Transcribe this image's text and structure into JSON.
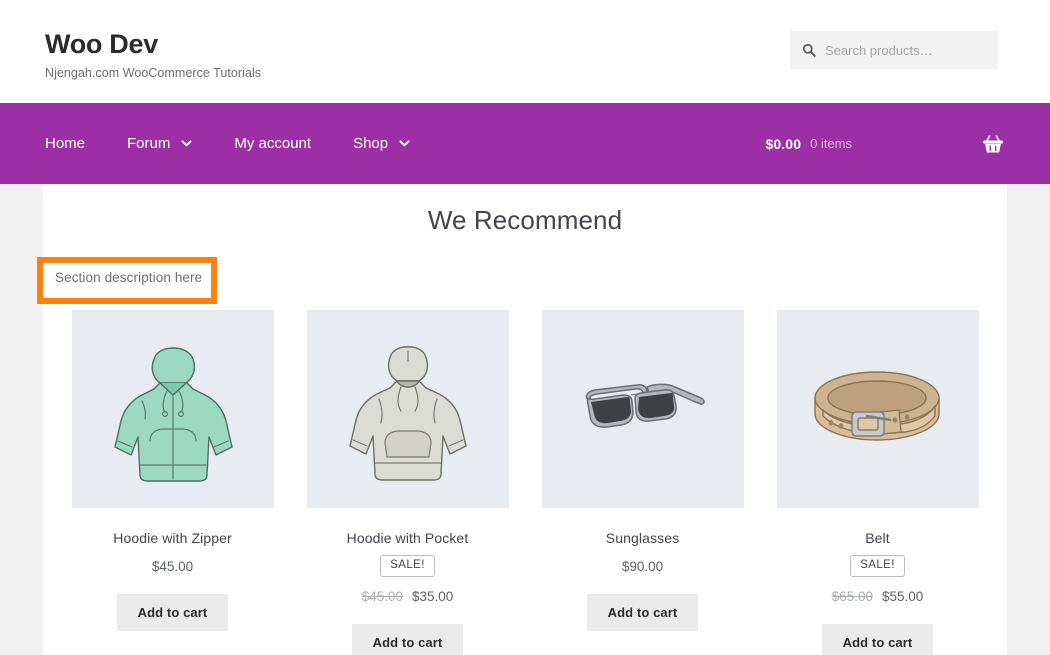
{
  "header": {
    "site_title": "Woo Dev",
    "tagline": "Njengah.com WooCommerce Tutorials",
    "search": {
      "placeholder": "Search products…",
      "value": "",
      "icon": "search-icon"
    }
  },
  "nav": {
    "background_color": "#9d2fa6",
    "items": [
      {
        "label": "Home",
        "has_dropdown": false
      },
      {
        "label": "Forum",
        "has_dropdown": true
      },
      {
        "label": "My account",
        "has_dropdown": false
      },
      {
        "label": "Shop",
        "has_dropdown": true
      }
    ],
    "cart": {
      "amount": "$0.00",
      "count": "0 items",
      "icon": "shopping-basket-icon"
    }
  },
  "section": {
    "heading": "We Recommend",
    "description": "Section description here"
  },
  "annotation": {
    "color": "#f98212",
    "target": "section-description"
  },
  "products": [
    {
      "title": "Hoodie with Zipper",
      "on_sale": false,
      "sale_label": "",
      "price": "$45.00",
      "regular_price": "",
      "button_label": "Add to cart",
      "image": "zip-hoodie",
      "image_color": "#9bd9c3"
    },
    {
      "title": "Hoodie with Pocket",
      "on_sale": true,
      "sale_label": "SALE!",
      "price": "$35.00",
      "regular_price": "$45.00",
      "button_label": "Add to cart",
      "image": "pocket-hoodie",
      "image_color": "#d6d6d0"
    },
    {
      "title": "Sunglasses",
      "on_sale": false,
      "sale_label": "",
      "price": "$90.00",
      "regular_price": "",
      "button_label": "Add to cart",
      "image": "sunglasses",
      "image_color": "#8d9095"
    },
    {
      "title": "Belt",
      "on_sale": true,
      "sale_label": "SALE!",
      "price": "$55.00",
      "regular_price": "$65.00",
      "button_label": "Add to cart",
      "image": "belt",
      "image_color": "#d2b491"
    }
  ],
  "theme": {
    "page_background": "#f1f1f1",
    "content_background": "#ffffff",
    "thumb_background": "#e8ecf1",
    "accent_purple": "#9d2fa6",
    "annotation_orange": "#f98212"
  }
}
